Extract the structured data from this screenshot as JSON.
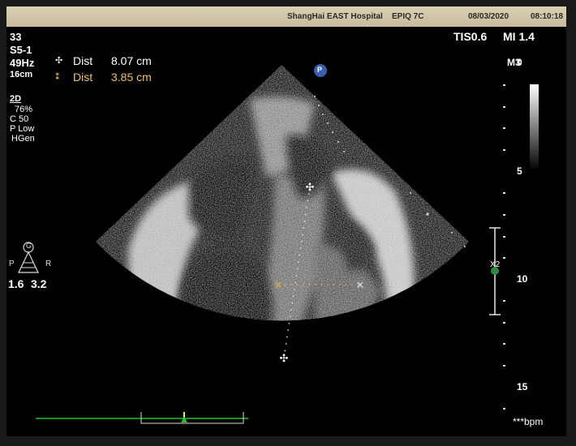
{
  "header": {
    "hospital": "ShangHai EAST Hospital",
    "system": "EPIQ 7C",
    "date": "08/03/2020",
    "time": "08:10:18"
  },
  "readout": {
    "frame": "33",
    "probe": "S5-1",
    "frame_rate": "49Hz",
    "depth": "16cm",
    "mode": "2D",
    "gain": "76%",
    "compression": "C 50",
    "power": "P Low",
    "resolution": "HGen",
    "tis": "TIS0.6",
    "mi": "MI 1.4"
  },
  "measurements": [
    {
      "symbol": "✣",
      "label": "Dist",
      "value": "8.07 cm",
      "color": "#ffffff"
    },
    {
      "symbol": "⁑",
      "label": "Dist",
      "value": "3.85 cm",
      "color": "#f0c060"
    }
  ],
  "orientation": {
    "badge": "G",
    "left_label": "P",
    "right_label": "R",
    "left_value": "1.6",
    "right_value": "3.2"
  },
  "probe_marker": "P",
  "depth_scale": {
    "labels": [
      "0",
      "5",
      "10",
      "15"
    ],
    "unit_label": "M3",
    "focus_label": "X2"
  },
  "heart_rate": "***bpm",
  "colors": {
    "header_bg": "#d3c8ab",
    "measurement_secondary": "#f0c060",
    "probe_marker": "#3b5fb0",
    "focus_marker": "#2e8b3e",
    "ecg_trace": "#22c22e"
  }
}
